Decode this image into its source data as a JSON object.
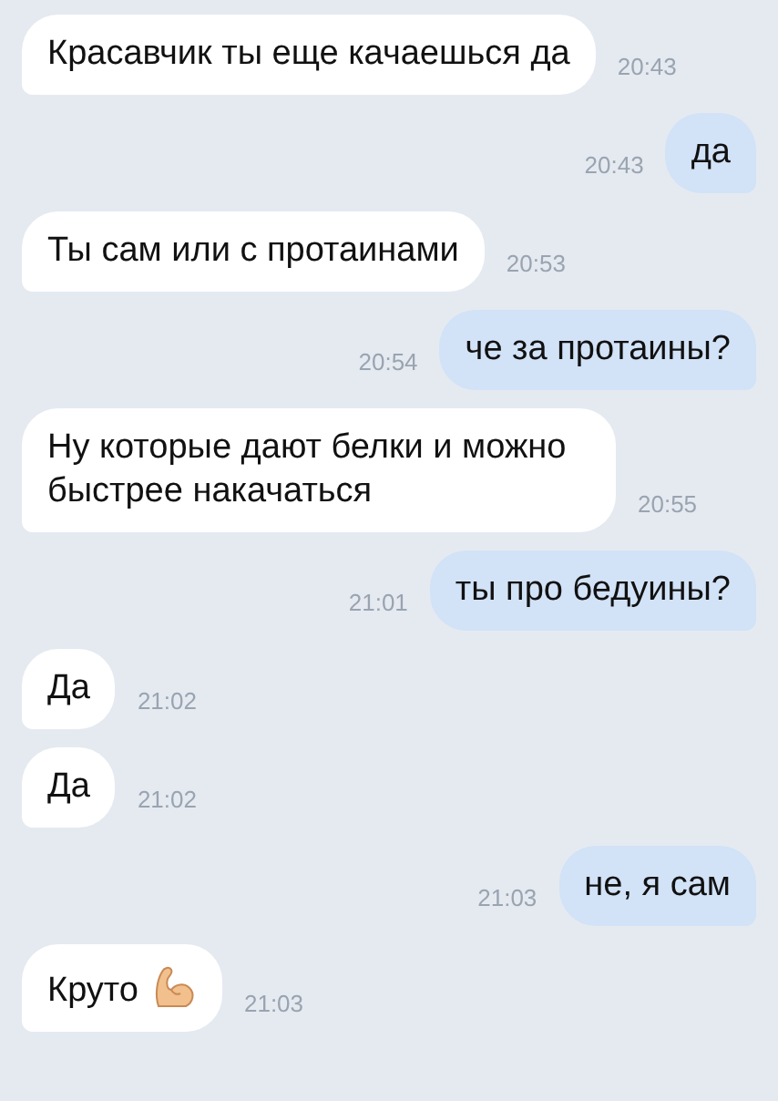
{
  "messages": [
    {
      "kind": "incoming",
      "text": "Красавчик ты еще качаешься да",
      "time": "20:43"
    },
    {
      "kind": "outgoing",
      "text": "да",
      "time": "20:43"
    },
    {
      "kind": "incoming",
      "text": "Ты сам или с протаинами",
      "time": "20:53"
    },
    {
      "kind": "outgoing",
      "text": "че за протаины?",
      "time": "20:54"
    },
    {
      "kind": "incoming",
      "text": "Ну которые дают белки и можно быстрее накачаться",
      "time": "20:55"
    },
    {
      "kind": "outgoing",
      "text": "ты про бедуины?",
      "time": "21:01"
    },
    {
      "kind": "incoming",
      "text": "Да",
      "time": "21:02"
    },
    {
      "kind": "incoming",
      "text": "Да",
      "time": "21:02"
    },
    {
      "kind": "outgoing",
      "text": "не, я сам",
      "time": "21:03"
    },
    {
      "kind": "incoming",
      "text": "Круто",
      "time": "21:03",
      "has_icon": true
    }
  ]
}
